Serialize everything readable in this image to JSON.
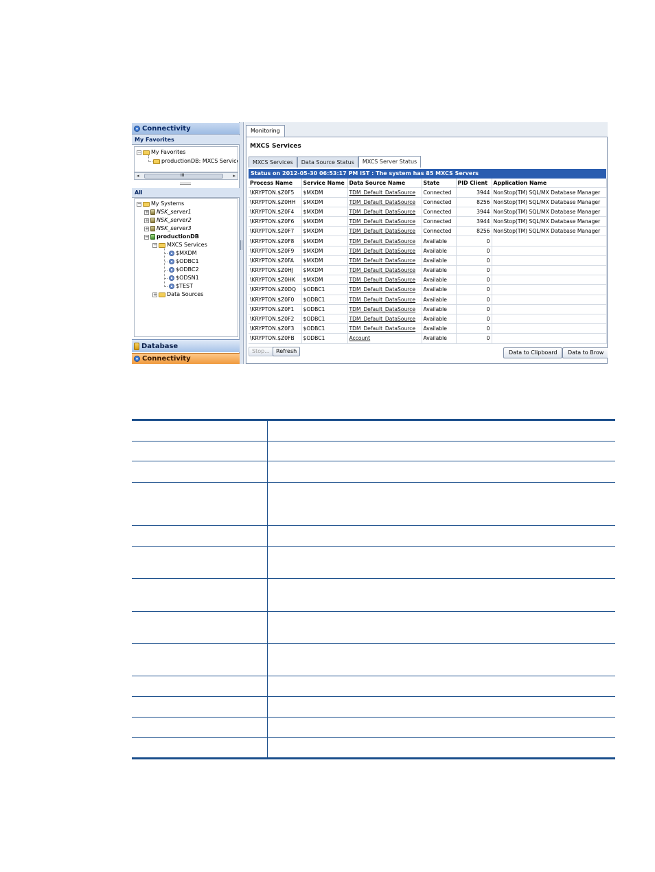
{
  "left_pane": {
    "connectivity_header": "Connectivity",
    "my_favorites_header": "My Favorites",
    "favorites_tree": {
      "root": "My Favorites",
      "child": "productionDB: MXCS Services"
    },
    "scroll_thumb_glyph": "III",
    "all_header": "All",
    "systems_tree": {
      "root": "My Systems",
      "servers": [
        "NSK_server1",
        "NSK_server2",
        "NSK_server3"
      ],
      "production": "productionDB",
      "mxcs_services": "MXCS Services",
      "services": [
        "$MXDM",
        "$ODBC1",
        "$ODBC2",
        "$ODSN1",
        "$TEST"
      ],
      "data_sources": "Data Sources"
    },
    "database_header": "Database",
    "connectivity_footer": "Connectivity"
  },
  "right_pane": {
    "main_tab": "Monitoring",
    "panel_title": "MXCS Services",
    "subtabs": [
      "MXCS Services",
      "Data Source Status",
      "MXCS Server Status"
    ],
    "active_subtab_index": 2,
    "status_text": "Status on 2012-05-30 06:53:17 PM IST : The system has 85 MXCS Servers",
    "table": {
      "columns": [
        "Process Name",
        "Service Name",
        "Data Source Name",
        "State",
        "PID Client",
        "Application Name"
      ],
      "rows": [
        [
          "\\KRYPTON.$Z0F5",
          "$MXDM",
          "TDM_Default_DataSource",
          "Connected",
          "3944",
          "NonStop(TM) SQL/MX Database Manager"
        ],
        [
          "\\KRYPTON.$Z0HH",
          "$MXDM",
          "TDM_Default_DataSource",
          "Connected",
          "8256",
          "NonStop(TM) SQL/MX Database Manager"
        ],
        [
          "\\KRYPTON.$Z0F4",
          "$MXDM",
          "TDM_Default_DataSource",
          "Connected",
          "3944",
          "NonStop(TM) SQL/MX Database Manager"
        ],
        [
          "\\KRYPTON.$Z0F6",
          "$MXDM",
          "TDM_Default_DataSource",
          "Connected",
          "3944",
          "NonStop(TM) SQL/MX Database Manager"
        ],
        [
          "\\KRYPTON.$Z0F7",
          "$MXDM",
          "TDM_Default_DataSource",
          "Connected",
          "8256",
          "NonStop(TM) SQL/MX Database Manager"
        ],
        [
          "\\KRYPTON.$Z0F8",
          "$MXDM",
          "TDM_Default_DataSource",
          "Available",
          "0",
          ""
        ],
        [
          "\\KRYPTON.$Z0F9",
          "$MXDM",
          "TDM_Default_DataSource",
          "Available",
          "0",
          ""
        ],
        [
          "\\KRYPTON.$Z0FA",
          "$MXDM",
          "TDM_Default_DataSource",
          "Available",
          "0",
          ""
        ],
        [
          "\\KRYPTON.$Z0HJ",
          "$MXDM",
          "TDM_Default_DataSource",
          "Available",
          "0",
          ""
        ],
        [
          "\\KRYPTON.$Z0HK",
          "$MXDM",
          "TDM_Default_DataSource",
          "Available",
          "0",
          ""
        ],
        [
          "\\KRYPTON.$Z0DQ",
          "$ODBC1",
          "TDM_Default_DataSource",
          "Available",
          "0",
          ""
        ],
        [
          "\\KRYPTON.$Z0F0",
          "$ODBC1",
          "TDM_Default_DataSource",
          "Available",
          "0",
          ""
        ],
        [
          "\\KRYPTON.$Z0F1",
          "$ODBC1",
          "TDM_Default_DataSource",
          "Available",
          "0",
          ""
        ],
        [
          "\\KRYPTON.$Z0F2",
          "$ODBC1",
          "TDM_Default_DataSource",
          "Available",
          "0",
          ""
        ],
        [
          "\\KRYPTON.$Z0F3",
          "$ODBC1",
          "TDM_Default_DataSource",
          "Available",
          "0",
          ""
        ],
        [
          "\\KRYPTON.$Z0FB",
          "$ODBC1",
          "Account",
          "Available",
          "0",
          ""
        ]
      ]
    },
    "buttons": {
      "stop": "Stop...",
      "refresh": "Refresh",
      "clipboard": "Data to Clipboard",
      "browser": "Data to Brow"
    }
  },
  "lower_table": {
    "rows": 12
  }
}
